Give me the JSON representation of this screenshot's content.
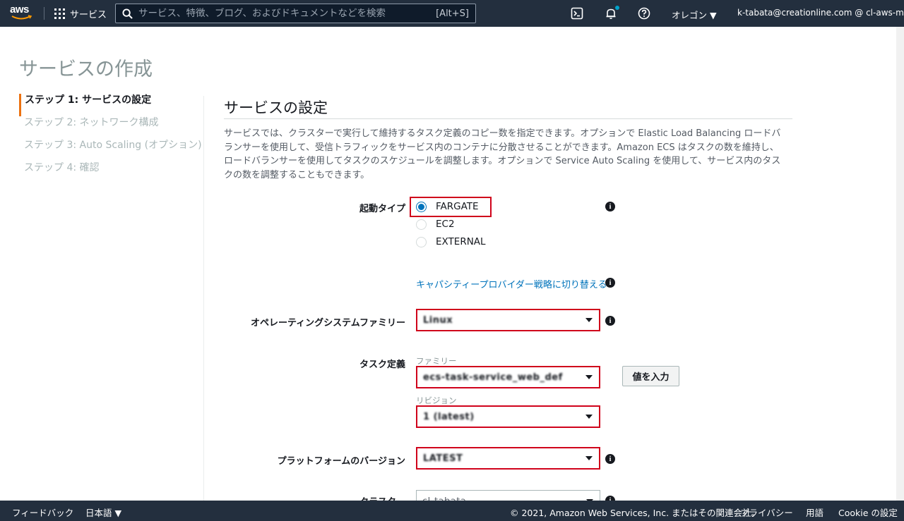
{
  "topnav": {
    "logo": "aws",
    "services_label": "サービス",
    "search_placeholder": "サービス、特徴、ブログ、およびドキュメントなどを検索",
    "search_shortcut": "[Alt+S]",
    "region": "オレゴン ▼",
    "account": "k-tabata@creationline.com @ cl-aws-ml ▼",
    "icons": [
      "cloudshell-icon",
      "bell-icon",
      "help-icon"
    ]
  },
  "page": {
    "title": "サービスの作成",
    "steps": [
      {
        "label": "ステップ 1: サービスの設定",
        "active": true
      },
      {
        "label": "ステップ 2: ネットワーク構成",
        "active": false
      },
      {
        "label": "ステップ 3: Auto Scaling (オプション)",
        "active": false
      },
      {
        "label": "ステップ 4: 確認",
        "active": false
      }
    ]
  },
  "section": {
    "title": "サービスの設定",
    "description": "サービスでは、クラスターで実行して維持するタスク定義のコピー数を指定できます。オプションで Elastic Load Balancing ロードバランサーを使用して、受信トラフィックをサービス内のコンテナに分散させることができます。Amazon ECS はタスクの数を維持し、ロードバランサーを使用してタスクのスケジュールを調整します。オプションで Service Auto Scaling を使用して、サービス内のタスクの数を調整することもできます。"
  },
  "form": {
    "launch_type": {
      "label": "起動タイプ",
      "options": [
        "FARGATE",
        "EC2",
        "EXTERNAL"
      ],
      "selected": "FARGATE"
    },
    "capacity_link": "キャパシティープロバイダー戦略に切り替える",
    "os_family": {
      "label": "オペレーティングシステムファミリー",
      "value": "Linux"
    },
    "task_definition": {
      "label": "タスク定義",
      "family_label": "ファミリー",
      "family_value": "ecs-task-service_web_def",
      "revision_label": "リビジョン",
      "revision_value": "1 (latest)",
      "enter_value_button": "値を入力"
    },
    "platform_version": {
      "label": "プラットフォームのバージョン",
      "value": "LATEST"
    },
    "cluster": {
      "label": "クラスター",
      "value": "cl-tabata"
    }
  },
  "footer": {
    "feedback": "フィードバック",
    "language": "日本語 ▼",
    "copyright": "© 2021, Amazon Web Services, Inc. またはその関連会社。",
    "privacy": "プライバシー",
    "terms": "用語",
    "cookie": "Cookie の設定"
  },
  "colors": {
    "nav_bg": "#232f3e",
    "accent_orange": "#ec7211",
    "link_blue": "#0073bb",
    "highlight_red": "#d0021b"
  }
}
